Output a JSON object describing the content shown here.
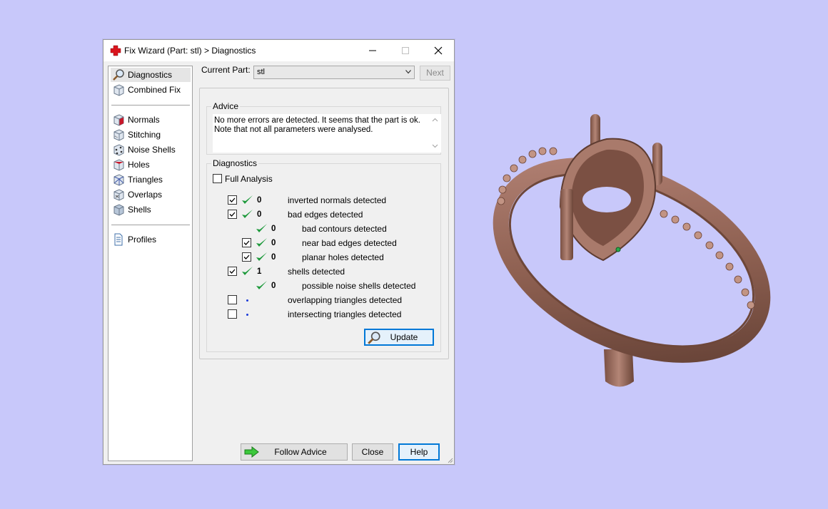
{
  "window": {
    "title": "Fix Wizard (Part: stl) > Diagnostics",
    "icon": "red-cross-icon"
  },
  "sidebar": {
    "items": [
      {
        "label": "Diagnostics",
        "icon": "magnifier-icon",
        "selected": true
      },
      {
        "label": "Combined Fix",
        "icon": "cube-icon"
      },
      {
        "label": "Normals",
        "icon": "normals-cube-icon"
      },
      {
        "label": "Stitching",
        "icon": "stitching-cube-icon"
      },
      {
        "label": "Noise Shells",
        "icon": "noise-shells-cube-icon"
      },
      {
        "label": "Holes",
        "icon": "holes-cube-icon"
      },
      {
        "label": "Triangles",
        "icon": "triangles-cube-icon"
      },
      {
        "label": "Overlaps",
        "icon": "overlaps-cube-icon"
      },
      {
        "label": "Shells",
        "icon": "shells-cube-icon"
      },
      {
        "label": "Profiles",
        "icon": "document-icon"
      }
    ]
  },
  "current_part": {
    "label": "Current Part:",
    "value": "stl",
    "next_label": "Next"
  },
  "advice": {
    "title": "Advice",
    "line1": "No more errors are detected. It seems that the part is ok.",
    "line2": "Note that not all parameters were analysed."
  },
  "diagnostics": {
    "title": "Diagnostics",
    "full_analysis_label": "Full Analysis",
    "full_analysis_checked": false,
    "rows": [
      {
        "checked": true,
        "has_checkbox": true,
        "status": "ok",
        "count": "0",
        "label": "inverted normals detected",
        "indent": 0
      },
      {
        "checked": true,
        "has_checkbox": true,
        "status": "ok",
        "count": "0",
        "label": "bad edges detected",
        "indent": 0
      },
      {
        "checked": false,
        "has_checkbox": false,
        "status": "ok",
        "count": "0",
        "label": "bad contours detected",
        "indent": 1
      },
      {
        "checked": true,
        "has_checkbox": true,
        "status": "ok",
        "count": "0",
        "label": "near bad edges detected",
        "indent": 1
      },
      {
        "checked": true,
        "has_checkbox": true,
        "status": "ok",
        "count": "0",
        "label": "planar holes detected",
        "indent": 1
      },
      {
        "checked": true,
        "has_checkbox": true,
        "status": "ok",
        "count": "1",
        "label": "shells detected",
        "indent": 0
      },
      {
        "checked": false,
        "has_checkbox": false,
        "status": "ok",
        "count": "0",
        "label": "possible noise shells detected",
        "indent": 1
      },
      {
        "checked": false,
        "has_checkbox": true,
        "status": "pending",
        "count": "",
        "label": "overlapping triangles detected",
        "indent": 0
      },
      {
        "checked": false,
        "has_checkbox": true,
        "status": "pending",
        "count": "",
        "label": "intersecting triangles detected",
        "indent": 0
      }
    ],
    "update_label": "Update"
  },
  "footer": {
    "follow_advice_label": "Follow Advice",
    "close_label": "Close",
    "help_label": "Help"
  },
  "colors": {
    "desktop": "#c8c8fa",
    "ring": "#9a6b5c",
    "check_green": "#1e9a3c",
    "accent": "#0078d7"
  }
}
